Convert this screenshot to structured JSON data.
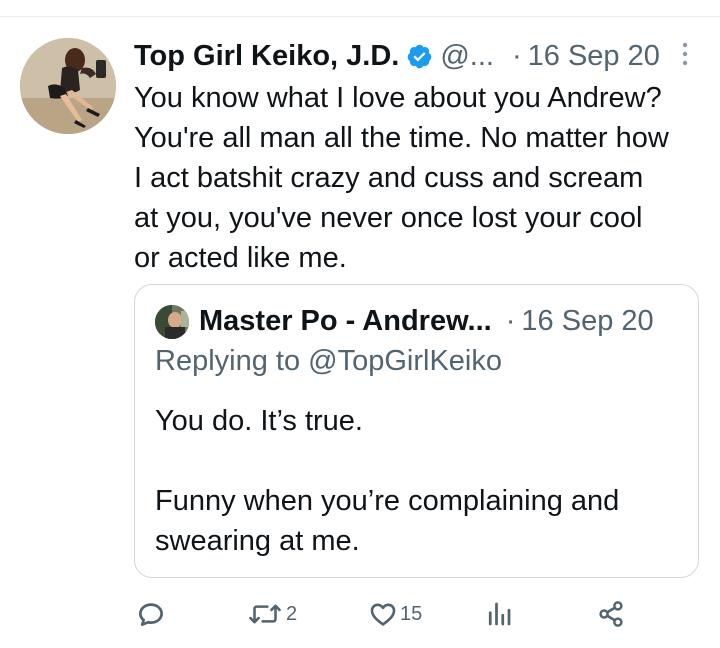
{
  "tweet": {
    "author_name": "Top Girl Keiko, J.D.",
    "handle": "@...",
    "separator": "·",
    "date": "16 Sep 20",
    "text": "You know what I love about you Andrew?\nYou're all man all the time. No matter how\nI act batshit crazy and cuss and scream\nat you, you've never once lost your cool\nor acted like me.",
    "avatar_icon": "profile-photo",
    "verified_icon": "verified-badge-icon",
    "more_icon": "more-vertical-icon"
  },
  "quoted_tweet": {
    "author_name": "Master Po - Andrew...",
    "separator": "·",
    "date": "16 Sep 20",
    "replying_to": "Replying to @TopGirlKeiko",
    "text": "You do. It’s true.\n\nFunny when you’re complaining and\nswearing at me."
  },
  "actions": {
    "reply": {
      "icon": "reply-icon",
      "count": ""
    },
    "retweet": {
      "icon": "retweet-icon",
      "count": "2"
    },
    "like": {
      "icon": "heart-icon",
      "count": "15"
    },
    "analytics": {
      "icon": "analytics-icon",
      "count": ""
    },
    "share": {
      "icon": "share-icon",
      "count": ""
    }
  },
  "colors": {
    "text_primary": "#0f1419",
    "text_secondary": "#536471",
    "verified": "#1d9bf0",
    "border": "#cfd9de",
    "background": "#ffffff"
  }
}
